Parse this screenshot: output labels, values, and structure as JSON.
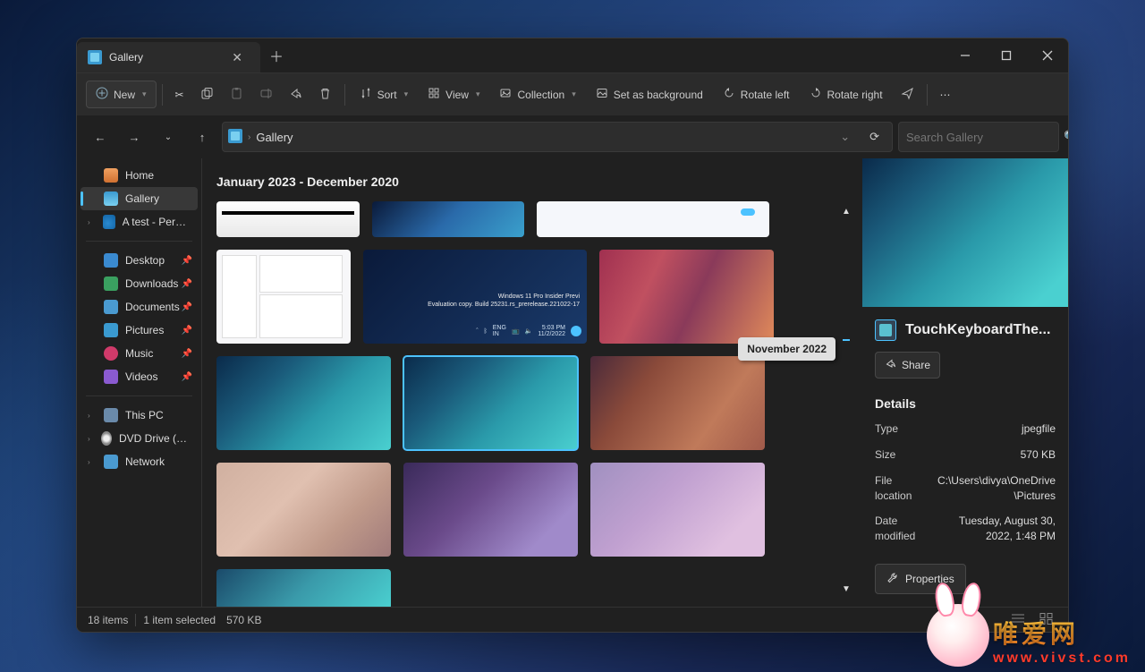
{
  "tab": {
    "title": "Gallery"
  },
  "toolbar": {
    "new": "New",
    "sort": "Sort",
    "view": "View",
    "collection": "Collection",
    "set_bg": "Set as background",
    "rotate_left": "Rotate left",
    "rotate_right": "Rotate right"
  },
  "address": {
    "crumb": "Gallery"
  },
  "search": {
    "placeholder": "Search Gallery"
  },
  "sidebar": {
    "home": "Home",
    "gallery": "Gallery",
    "atest": "A test - Personal",
    "desktop": "Desktop",
    "downloads": "Downloads",
    "documents": "Documents",
    "pictures": "Pictures",
    "music": "Music",
    "videos": "Videos",
    "thispc": "This PC",
    "dvd": "DVD Drive (D:) CCC",
    "network": "Network"
  },
  "gallery": {
    "range": "January 2023 - December 2020",
    "tooltip": "November 2022",
    "insider_line1": "Windows 11 Pro Insider Previ",
    "insider_line2": "Evaluation copy. Build 25231.rs_prerelease.221022-17",
    "task_lang": "ENG",
    "task_region": "IN",
    "task_time": "5:03 PM",
    "task_date": "11/2/2022"
  },
  "details": {
    "filename": "TouchKeyboardThe...",
    "share": "Share",
    "heading": "Details",
    "type_k": "Type",
    "type_v": "jpegfile",
    "size_k": "Size",
    "size_v": "570 KB",
    "loc_k": "File location",
    "loc_v": "C:\\Users\\divya\\OneDrive\\Pictures",
    "mod_k": "Date modified",
    "mod_v": "Tuesday, August 30, 2022, 1:48 PM",
    "properties": "Properties"
  },
  "status": {
    "count": "18 items",
    "sel": "1 item selected",
    "size": "570 KB"
  },
  "watermark": {
    "cn": "唯爱网",
    "url": "www.vivst.com"
  }
}
